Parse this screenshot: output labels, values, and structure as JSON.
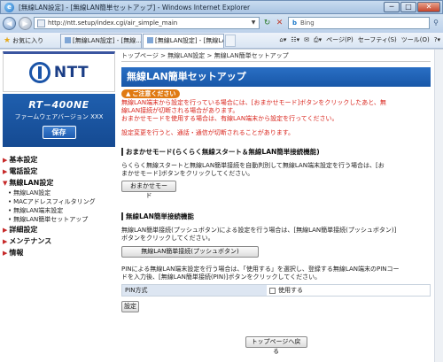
{
  "window": {
    "title": "[無線LAN設定] - [無線LAN簡単セットアップ] - Windows Internet Explorer",
    "minimize": "─",
    "maximize": "□",
    "close": "✕"
  },
  "address_bar": {
    "url": "http://ntt.setup/index.cgi/air_simple_main",
    "search_placeholder": "Bing"
  },
  "command_bar": {
    "favorites": "お気に入り",
    "tabs": [
      {
        "label": "[無線LAN設定] - [無線..."
      },
      {
        "label": "[無線LAN設定] - [無線LAN簡単セ..."
      }
    ],
    "page_menu": "ページ(P)",
    "safety_menu": "セーフティ(S)",
    "tools_menu": "ツール(O)"
  },
  "sidebar": {
    "logo_text": "NTT",
    "model": "RT−400NE",
    "firmware": "ファームウェアバージョン XXX",
    "save_label": "保存",
    "menu": [
      {
        "label": "基本設定"
      },
      {
        "label": "電話設定"
      },
      {
        "label": "無線LAN設定"
      },
      {
        "label": "無線LAN設定",
        "sub": true
      },
      {
        "label": "MACアドレスフィルタリング",
        "sub": true
      },
      {
        "label": "無線LAN端末設定",
        "sub": true
      },
      {
        "label": "無線LAN簡単セットアップ",
        "sub": true
      },
      {
        "label": "詳細設定"
      },
      {
        "label": "メンテナンス"
      },
      {
        "label": "情報"
      }
    ]
  },
  "main": {
    "breadcrumb": "トップページ > 無線LAN設定 > 無線LAN簡単セットアップ",
    "title": "無線LAN簡単セットアップ",
    "notice_badge": "ご注意ください",
    "warning_line1": "無線LAN端末から設定を行っている場合には、[おまかせモード]ボタンをクリックしたあと、無",
    "warning_line2": "線LAN接続が切断される場合があります。",
    "warning_line3": "おまかせモードを使用する場合は、有線LAN端末から設定を行ってください。",
    "warning_line4": "設定変更を行うと、通話・通信が切断されることがあります。",
    "section1_title": "おまかせモード(らくらく無線スタート＆無線LAN簡単接続機能)",
    "section1_desc1": "らくらく無線スタートと無線LAN簡単接続を自動判別して無線LAN端末設定を行う場合は、[お",
    "section1_desc2": "まかせモード]ボタンをクリックしてください。",
    "omakase_button": "おまかせモード",
    "section2_title": "無線LAN簡単接続機能",
    "section2_desc1": "無線LAN簡単接続(プッシュボタン)による設定を行う場合は、[無線LAN簡単接続(プッシュボタン)]",
    "section2_desc2": "ボタンをクリックしてください。",
    "push_button": "無線LAN簡単接続(プッシュボタン)",
    "pin_desc1": "PINによる無線LAN端末設定を行う場合は、「使用する」を選択し、登録する無線LAN端末のPINコー",
    "pin_desc2": "ドを入力後、[無線LAN簡単接続(PIN)]ボタンをクリックしてください。",
    "pin_label": "PIN方式",
    "pin_option": "使用する",
    "set_button": "設定",
    "back_button": "トップページへ戻る"
  }
}
